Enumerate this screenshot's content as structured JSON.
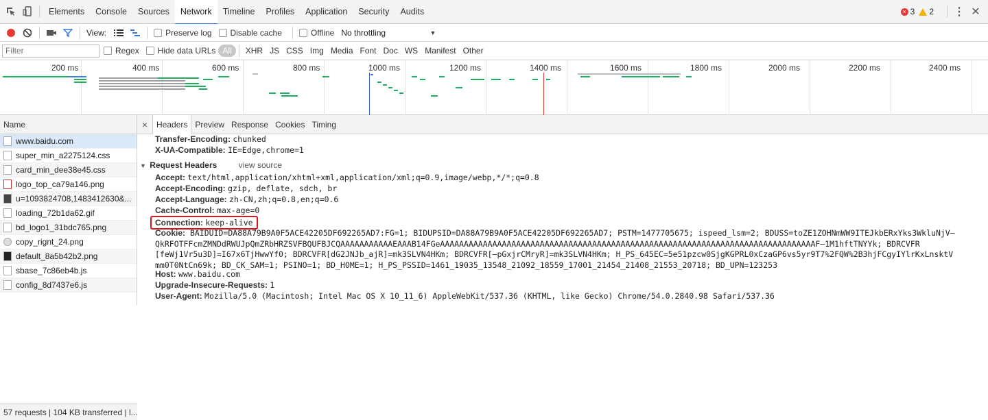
{
  "tabs": {
    "items": [
      "Elements",
      "Console",
      "Sources",
      "Network",
      "Timeline",
      "Profiles",
      "Application",
      "Security",
      "Audits"
    ],
    "error_count": "3",
    "warning_count": "2"
  },
  "toolbar": {
    "view_label": "View:",
    "preserve_log": "Preserve log",
    "disable_cache": "Disable cache",
    "offline": "Offline",
    "throttling": "No throttling"
  },
  "filter": {
    "placeholder": "Filter",
    "regex": "Regex",
    "hide_data_urls": "Hide data URLs",
    "types": [
      "All",
      "XHR",
      "JS",
      "CSS",
      "Img",
      "Media",
      "Font",
      "Doc",
      "WS",
      "Manifest",
      "Other"
    ]
  },
  "overview": {
    "ticks": [
      "200 ms",
      "400 ms",
      "600 ms",
      "800 ms",
      "1000 ms",
      "1200 ms",
      "1400 ms",
      "1600 ms",
      "1800 ms",
      "2000 ms",
      "2200 ms",
      "2400 ms"
    ]
  },
  "requests": {
    "header": "Name",
    "items": [
      "www.baidu.com",
      "super_min_a2275124.css",
      "card_min_dee38e45.css",
      "logo_top_ca79a146.png",
      "u=1093824708,1483412630&...",
      "loading_72b1da62.gif",
      "bd_logo1_31bdc765.png",
      "copy_rignt_24.png",
      "default_8a5b42b2.png",
      "sbase_7c86eb4b.js",
      "config_8d7437e6.js"
    ],
    "status": "57 requests | 104 KB transferred | l..."
  },
  "detail": {
    "close": "×",
    "tabs": [
      "Headers",
      "Preview",
      "Response",
      "Cookies",
      "Timing"
    ],
    "response_tail": [
      {
        "k": "Transfer-Encoding:",
        "v": "chunked"
      },
      {
        "k": "X-UA-Compatible:",
        "v": "IE=Edge,chrome=1"
      }
    ],
    "request_section": "Request Headers",
    "view_source": "view source",
    "request_headers": [
      {
        "k": "Accept:",
        "v": "text/html,application/xhtml+xml,application/xml;q=0.9,image/webp,*/*;q=0.8"
      },
      {
        "k": "Accept-Encoding:",
        "v": "gzip, deflate, sdch, br"
      },
      {
        "k": "Accept-Language:",
        "v": "zh-CN,zh;q=0.8,en;q=0.6"
      },
      {
        "k": "Cache-Control:",
        "v": "max-age=0"
      },
      {
        "k": "Connection:",
        "v": "keep-alive"
      }
    ],
    "cookie_key": "Cookie:",
    "cookie_lines": [
      "BAIDUID=DA88A79B9A0F5ACE42205DF692265AD7:FG=1; BIDUPSID=DA88A79B9A0F5ACE42205DF692265AD7; PSTM=1477705675; ispeed_lsm=2; BDUSS=toZE1ZOHNmWW9ITEJkbERxYks3WkluNjV–",
      "QkRFOTFFcmZMNDdRWUJpQmZRbHRZSVFBQUFBJCQAAAAAAAAAAAEAAAB14FGeAAAAAAAAAAAAAAAAAAAAAAAAAAAAAAAAAAAAAAAAAAAAAAAAAAAAAAAAAAAAAAAAAAAAAAAAAAAAAAAF–1M1hftTNYYk; BDRCVFR",
      "[feWj1Vr5u3D]=I67x6TjHwwYf0; BDRCVFR[dG2JNJb_ajR]=mk3SLVN4HKm; BDRCVFR[–pGxjrCMryR]=mk3SLVN4HKm; H_PS_645EC=5e51pzcw0SjgKGPRL0xCzaGP6vs5yr9T7%2FQW%2B3hjFCgyIYlrKxLnsktV",
      "mm0T0NtCn69k; BD_CK_SAM=1; PSINO=1; BD_HOME=1; H_PS_PSSID=1461_19035_13548_21092_18559_17001_21454_21408_21553_20718; BD_UPN=123253"
    ],
    "after_cookie": [
      {
        "k": "Host:",
        "v": "www.baidu.com"
      },
      {
        "k": "Upgrade-Insecure-Requests:",
        "v": "1"
      },
      {
        "k": "User-Agent:",
        "v": "Mozilla/5.0 (Macintosh; Intel Mac OS X 10_11_6) AppleWebKit/537.36 (KHTML, like Gecko) Chrome/54.0.2840.98 Safari/537.36"
      }
    ]
  },
  "colors": {
    "accent": "#3879d9",
    "record": "#e53935",
    "highlight_box": "#e0141e",
    "waterfall_green": "#1fae5b",
    "waterfall_gray": "#9e9e9e",
    "waterfall_blue": "#3d7ee0"
  }
}
